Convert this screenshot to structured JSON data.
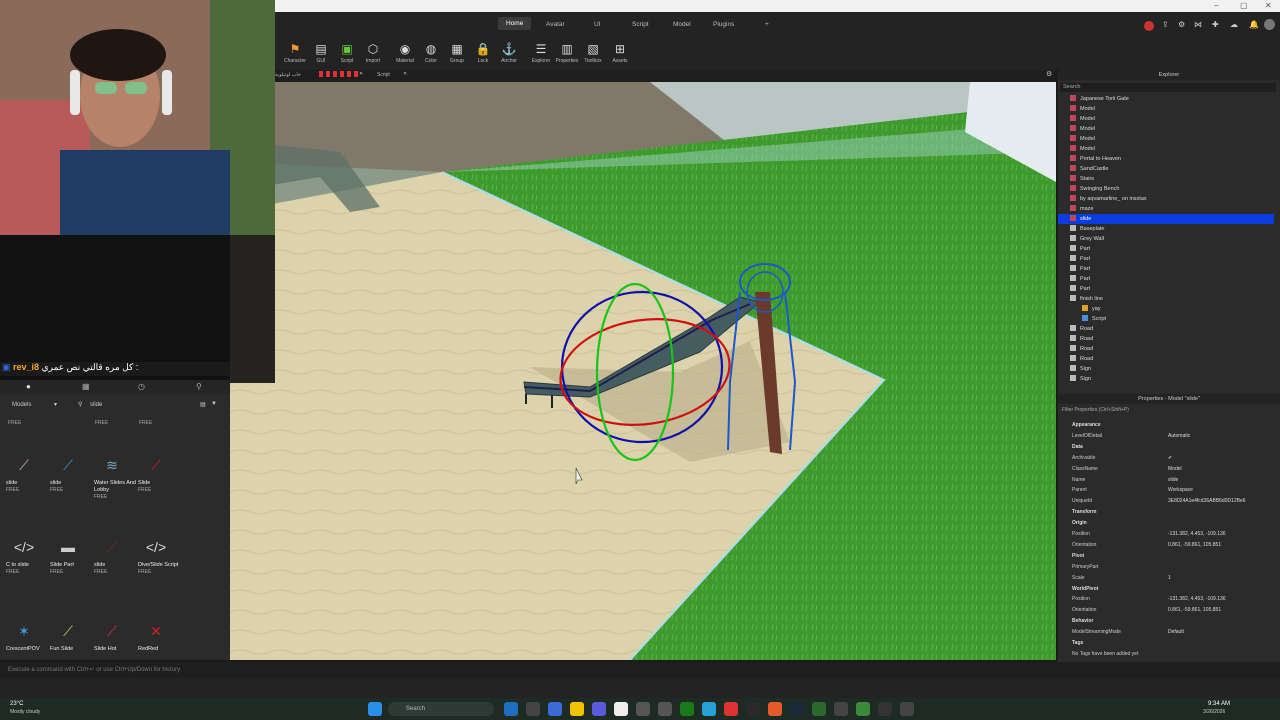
{
  "menu": {
    "tabs": [
      "Home",
      "Avatar",
      "UI",
      "Script",
      "Model",
      "Plugins",
      "+"
    ],
    "active": "Home"
  },
  "toolbar": {
    "tools": [
      {
        "label": "Character",
        "icon": "character-icon",
        "glyph": "⚑"
      },
      {
        "label": "GUI",
        "icon": "gui-icon",
        "glyph": "▤"
      },
      {
        "label": "Script",
        "icon": "script-icon",
        "glyph": "▣"
      },
      {
        "label": "Import",
        "icon": "import-icon",
        "glyph": "⬡"
      },
      {
        "label": "Material",
        "icon": "material-icon",
        "glyph": "◉"
      },
      {
        "label": "Color",
        "icon": "color-icon",
        "glyph": "◍"
      },
      {
        "label": "Group",
        "icon": "group-icon",
        "glyph": "▦"
      },
      {
        "label": "Lock",
        "icon": "lock-icon",
        "glyph": "🔒"
      },
      {
        "label": "Anchor",
        "icon": "anchor-icon",
        "glyph": "⚓"
      },
      {
        "label": "Explorer",
        "icon": "explorer-icon",
        "glyph": "☰"
      },
      {
        "label": "Properties",
        "icon": "properties-icon",
        "glyph": "▥"
      },
      {
        "label": "Toolbox",
        "icon": "toolbox-icon",
        "glyph": "▧"
      },
      {
        "label": "Assets",
        "icon": "assets-icon",
        "glyph": "⊞"
      }
    ]
  },
  "doc_tabs": {
    "tab1": "خاب لوتيلوية",
    "tab2": "Script"
  },
  "chat": {
    "user": "rev_i8",
    "message": "كل مره قالتي نص عمري :"
  },
  "toolbox": {
    "category": "Models",
    "search": "slide",
    "top_row": [
      {
        "price": "FREE"
      },
      {
        "price": "FREE"
      },
      {
        "price": "FREE"
      }
    ],
    "assets": [
      {
        "name": "slide",
        "price": "FREE",
        "icon": "pink-slide-icon"
      },
      {
        "name": "slide",
        "price": "FREE",
        "icon": "blue-slide-icon"
      },
      {
        "name": "Water Slides And Lobby",
        "price": "FREE",
        "icon": "water-slides-icon"
      },
      {
        "name": "Slide",
        "price": "FREE",
        "icon": "red-slide-icon"
      },
      {
        "name": "C to slide",
        "price": "FREE",
        "icon": "code-icon"
      },
      {
        "name": "Slide Part",
        "price": "FREE",
        "icon": "slide-part-icon"
      },
      {
        "name": "slide",
        "price": "FREE",
        "icon": "dark-slide-icon"
      },
      {
        "name": "Dive/Slide Script",
        "price": "FREE",
        "icon": "code-icon"
      },
      {
        "name": "CrescentPOV",
        "price": "",
        "icon": "crescent-icon"
      },
      {
        "name": "Fun Slide",
        "price": "",
        "icon": "fun-slide-icon"
      },
      {
        "name": "Slide Hot",
        "price": "",
        "icon": "hot-slide-icon"
      },
      {
        "name": "RedRed",
        "price": "",
        "icon": "redred-icon"
      }
    ]
  },
  "explorer": {
    "title": "Explorer",
    "search_placeholder": "Search",
    "items": [
      {
        "name": "Japanese Torii Gate",
        "type": "model"
      },
      {
        "name": "Model",
        "type": "model"
      },
      {
        "name": "Model",
        "type": "model"
      },
      {
        "name": "Model",
        "type": "model"
      },
      {
        "name": "Model",
        "type": "model"
      },
      {
        "name": "Model",
        "type": "model"
      },
      {
        "name": "Portal to Heaven",
        "type": "model"
      },
      {
        "name": "SandCastle",
        "type": "model"
      },
      {
        "name": "Stairs",
        "type": "model"
      },
      {
        "name": "Swinging Bench",
        "type": "model"
      },
      {
        "name": "by aqvamarline_ on insxtax",
        "type": "model"
      },
      {
        "name": "maze",
        "type": "model"
      },
      {
        "name": "slide",
        "type": "model",
        "selected": true
      },
      {
        "name": "Baseplate",
        "type": "part"
      },
      {
        "name": "Grey Wall",
        "type": "part"
      },
      {
        "name": "Part",
        "type": "part"
      },
      {
        "name": "Part",
        "type": "part"
      },
      {
        "name": "Part",
        "type": "part"
      },
      {
        "name": "Part",
        "type": "part"
      },
      {
        "name": "Part",
        "type": "part"
      },
      {
        "name": "finish line",
        "type": "part"
      },
      {
        "name": "yay",
        "type": "sound"
      },
      {
        "name": "Script",
        "type": "script"
      },
      {
        "name": "Road",
        "type": "part"
      },
      {
        "name": "Road",
        "type": "part"
      },
      {
        "name": "Road",
        "type": "part"
      },
      {
        "name": "Road",
        "type": "part"
      },
      {
        "name": "Sign",
        "type": "part"
      },
      {
        "name": "Sign",
        "type": "part"
      }
    ]
  },
  "properties": {
    "title": "Properties - Model \"slide\"",
    "filter_placeholder": "Filter Properties (Ctrl+Shift+P)",
    "rows": [
      {
        "k": "Appearance",
        "v": "",
        "cat": true
      },
      {
        "k": "LevelOfDetail",
        "v": "Automatic"
      },
      {
        "k": "Data",
        "v": "",
        "cat": true
      },
      {
        "k": "Archivable",
        "v": "✔"
      },
      {
        "k": "ClassName",
        "v": "Model"
      },
      {
        "k": "Name",
        "v": "slide"
      },
      {
        "k": "Parent",
        "v": "Workspace"
      },
      {
        "k": "UniqueId",
        "v": "3E8024A1e4fcd36ABB6d0D12Be6"
      },
      {
        "k": "Transform",
        "v": "",
        "cat": true
      },
      {
        "k": "Origin",
        "v": "",
        "cat": true
      },
      {
        "k": "Position",
        "v": "-131.382, 4.453, -109.136"
      },
      {
        "k": "Orientation",
        "v": "0.861, -59.861, 105.851"
      },
      {
        "k": "Pivot",
        "v": "",
        "cat": true
      },
      {
        "k": "PrimaryPart",
        "v": ""
      },
      {
        "k": "Scale",
        "v": "1"
      },
      {
        "k": "WorldPivot",
        "v": "",
        "cat": true
      },
      {
        "k": "Position",
        "v": "-131.382, 4.453, -109.136"
      },
      {
        "k": "Orientation",
        "v": "0.861, -59.861, 105.851"
      },
      {
        "k": "Behavior",
        "v": "",
        "cat": true
      },
      {
        "k": "ModelStreamingMode",
        "v": "Default"
      },
      {
        "k": "Tags",
        "v": "",
        "cat": true
      },
      {
        "k": "No Tags have been added yet",
        "v": ""
      }
    ]
  },
  "command_bar": {
    "placeholder": "Execute a command with Ctrl+↵ or use Ctrl+Up/Down for history"
  },
  "taskbar": {
    "weather_temp": "23°C",
    "weather_text": "Mostly cloudy",
    "search_placeholder": "Search",
    "time": "9:34 AM",
    "date": "3/26/2026"
  }
}
